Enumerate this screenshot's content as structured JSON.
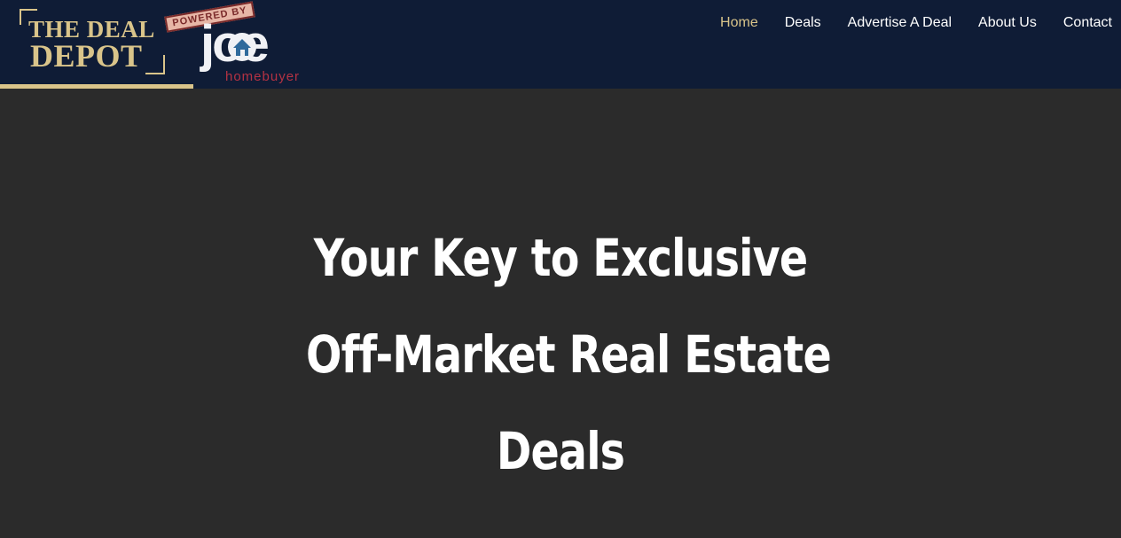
{
  "brand": {
    "logo_line1": "THE DEAL",
    "logo_line2": "DEPOT",
    "stamp_text": "POWERED BY",
    "partner_word": "joe",
    "partner_subtext": "homebuyer"
  },
  "nav": {
    "items": [
      {
        "label": "Home",
        "active": true
      },
      {
        "label": "Deals",
        "active": false
      },
      {
        "label": "Advertise A Deal",
        "active": false
      },
      {
        "label": "About Us",
        "active": false
      },
      {
        "label": "Contact",
        "active": false
      }
    ]
  },
  "hero": {
    "title_lines": [
      "Your Key to Exclusive",
      "Off-Market Real Estate",
      "Deals"
    ]
  },
  "colors": {
    "header_bg": "#0f1c36",
    "hero_bg": "#2b2b2b",
    "accent_gold": "#d9c48a",
    "brand_red": "#b43243",
    "text_white": "#ffffff"
  }
}
